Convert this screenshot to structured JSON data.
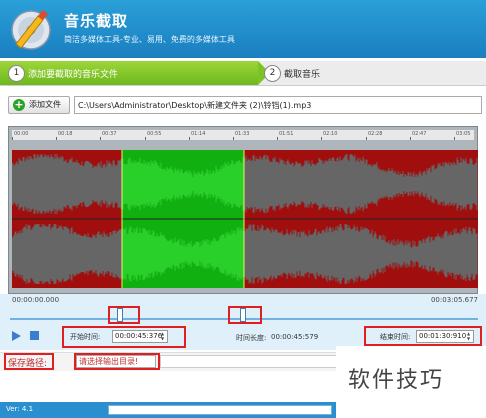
{
  "header": {
    "title": "音乐截取",
    "subtitle": "简洁多媒体工具-专业、易用、免费的多媒体工具"
  },
  "steps": [
    {
      "number": "1",
      "label": "添加要截取的音乐文件"
    },
    {
      "number": "2",
      "label": "截取音乐"
    }
  ],
  "file": {
    "add_button_label": "添加文件",
    "path": "C:\\Users\\Administrator\\Desktop\\新建文件夹 (2)\\铃铛(1).mp3"
  },
  "ruler": {
    "ticks": [
      "00:00",
      "00:18",
      "00:37",
      "00:55",
      "01:14",
      "01:33",
      "01:51",
      "02:10",
      "02:28",
      "02:47",
      "03:05"
    ]
  },
  "waveform": {
    "selection_start_fraction": 0.236,
    "selection_end_fraction": 0.497,
    "colors": {
      "background": "#3c3c3c",
      "outside": "#a00e0e",
      "selected": "#10b010",
      "wave_outside": "#666666",
      "wave_selected": "#2ad02a"
    }
  },
  "timeline": {
    "start_time": "00:00:00.000",
    "end_time": "00:03:05.677",
    "marker_start_fraction": 0.236,
    "marker_end_fraction": 0.497
  },
  "controls": {
    "start_label": "开始时间:",
    "start_value": "00:00:45:376",
    "duration_label": "时间长度:",
    "duration_value": "00:00:45:579",
    "end_label": "结束时间:",
    "end_value": "00:01:30:910"
  },
  "save": {
    "label": "保存路径:",
    "value": "请选择输出目录!"
  },
  "watermark": {
    "text": "软件技巧"
  },
  "status": {
    "version": "Ver: 4.1"
  },
  "accent_color": "#1a7fc0",
  "highlight_color": "#e02020"
}
